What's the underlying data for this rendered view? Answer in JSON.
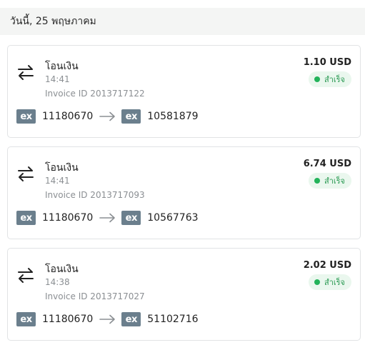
{
  "date_header": "วันนี้, 25 พฤษภาคม",
  "transactions": [
    {
      "title": "โอนเงิน",
      "time": "14:41",
      "invoice": "Invoice ID 2013717122",
      "amount": "1.10 USD",
      "status": "สำเร็จ",
      "from_badge": "ex",
      "from_account": "11180670",
      "to_badge": "ex",
      "to_account": "10581879"
    },
    {
      "title": "โอนเงิน",
      "time": "14:41",
      "invoice": "Invoice ID 2013717093",
      "amount": "6.74 USD",
      "status": "สำเร็จ",
      "from_badge": "ex",
      "from_account": "11180670",
      "to_badge": "ex",
      "to_account": "10567763"
    },
    {
      "title": "โอนเงิน",
      "time": "14:38",
      "invoice": "Invoice ID 2013717027",
      "amount": "2.02 USD",
      "status": "สำเร็จ",
      "from_badge": "ex",
      "from_account": "11180670",
      "to_badge": "ex",
      "to_account": "51102716"
    }
  ],
  "colors": {
    "header_bg": "#f4f5f4",
    "badge_bg": "#6b7f8d",
    "success_green": "#23b35a",
    "success_bg": "#eaf7ee",
    "muted_text": "#8b8f93"
  },
  "icons": {
    "transfer": "swap-arrows-icon",
    "route": "arrow-right-icon"
  }
}
